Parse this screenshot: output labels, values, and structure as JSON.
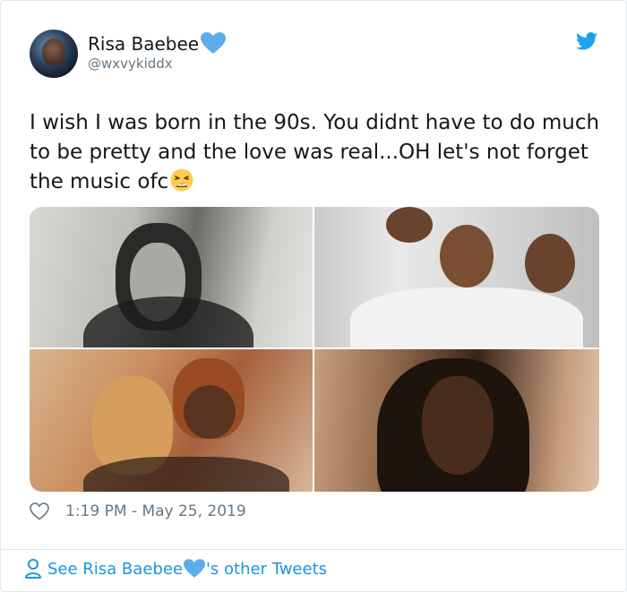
{
  "tweet": {
    "display_name": "Risa Baebee",
    "handle": "@wxvykiddx",
    "text": "I wish I was born in the 90s. You didnt have to do much to be pretty and the love was real...OH let's not forget the music ofc",
    "timestamp": "1:19 PM - May 25, 2019",
    "photo_count": 4
  },
  "footer": {
    "link_prefix": "See Risa Baebee",
    "link_suffix": "'s other Tweets"
  },
  "icons": {
    "brand": "twitter-bird-icon",
    "name_emoji": "blue-heart-icon",
    "text_emoji": "weary-face-icon",
    "like": "heart-outline-icon",
    "profile": "person-icon"
  },
  "colors": {
    "link": "#1b95e0",
    "twitter_blue": "#1da1f2",
    "muted": "#657786",
    "text": "#14171a",
    "border": "#e1e8ed"
  }
}
